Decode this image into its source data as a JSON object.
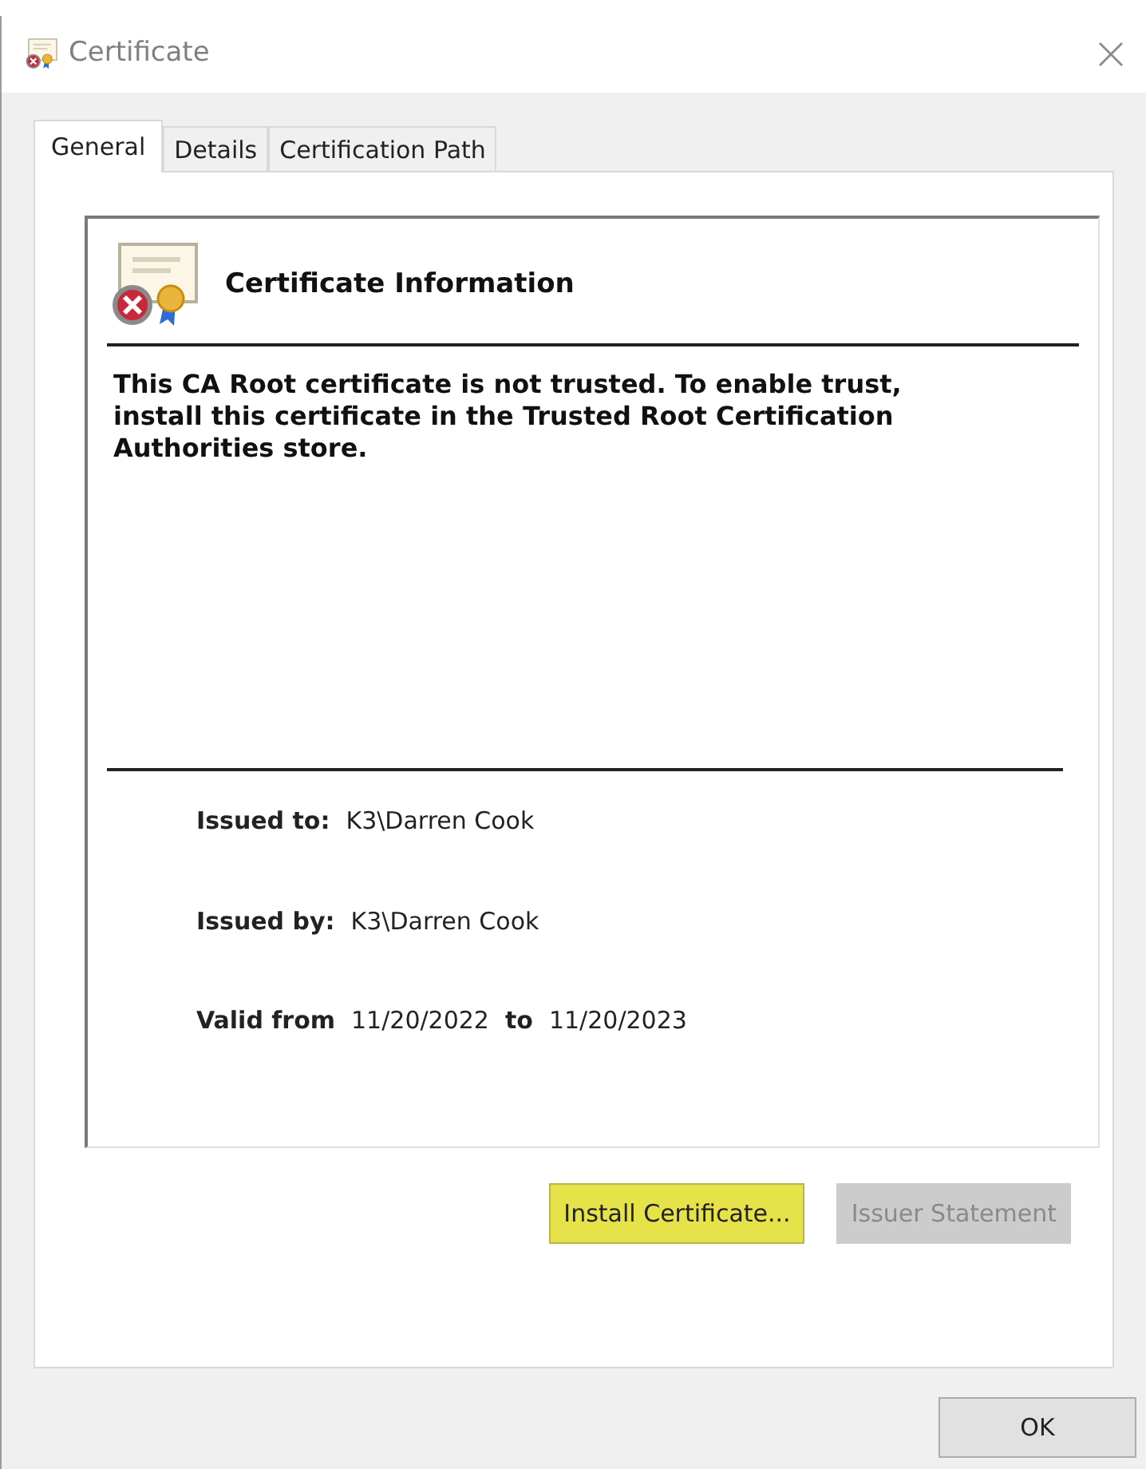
{
  "window": {
    "title": "Certificate"
  },
  "tabs": [
    {
      "label": "General",
      "selected": true
    },
    {
      "label": "Details",
      "selected": false
    },
    {
      "label": "Certification Path",
      "selected": false
    }
  ],
  "info": {
    "heading": "Certificate Information",
    "message": "This CA Root certificate is not trusted. To enable trust, install this certificate in the Trusted Root Certification Authorities store."
  },
  "fields": [
    {
      "kind": "single",
      "label": "Issued to:",
      "value": "K3\\Darren Cook"
    },
    {
      "kind": "single",
      "label": "Issued by:",
      "value": "K3\\Darren Cook"
    },
    {
      "kind": "range",
      "label": "Valid from",
      "value": "11/20/2022",
      "joiner": "to",
      "value2": "11/20/2023"
    }
  ],
  "buttons": [
    {
      "label": "Install Certificate...",
      "disabled": false,
      "highlighted": true
    },
    {
      "label": "Issuer Statement",
      "disabled": true,
      "highlighted": false
    }
  ],
  "ok_button": {
    "label": "OK"
  }
}
